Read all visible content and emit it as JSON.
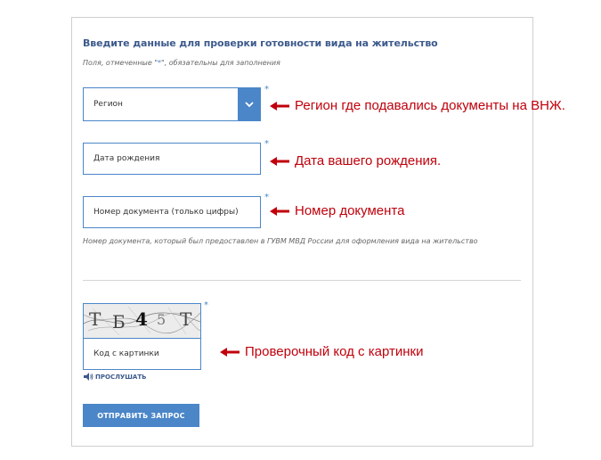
{
  "form": {
    "title": "Введите данные для проверки готовности вида на жительство",
    "required_note_prefix": "Поля, отмеченные \"",
    "required_note_star": "*",
    "required_note_suffix": "\", обязательны для заполнения",
    "region_placeholder": "Регион",
    "birth_placeholder": "Дата рождения",
    "doc_placeholder": "Номер документа (только цифры)",
    "doc_hint": "Номер документа, который был предоставлен в ГУВМ МВД России для оформления вида на жительство",
    "required_star": "*",
    "captcha_chars": [
      "Т",
      "Б",
      "4",
      "5",
      "Т"
    ],
    "captcha_placeholder": "Код с картинки",
    "listen_label": "ПРОСЛУШАТЬ",
    "submit_label": "ОТПРАВИТЬ ЗАПРОС",
    "icons": {
      "select": "chevron-down-icon",
      "listen": "speaker-icon"
    }
  },
  "annotations": {
    "region": "Регион где подавались документы на ВНЖ.",
    "birth": "Дата вашего рождения.",
    "doc": "Номер документа",
    "captcha": "Проверочный код с картинки"
  },
  "colors": {
    "accent": "#4a86c8",
    "title": "#3c5a8c",
    "annotation": "#c0000b"
  }
}
